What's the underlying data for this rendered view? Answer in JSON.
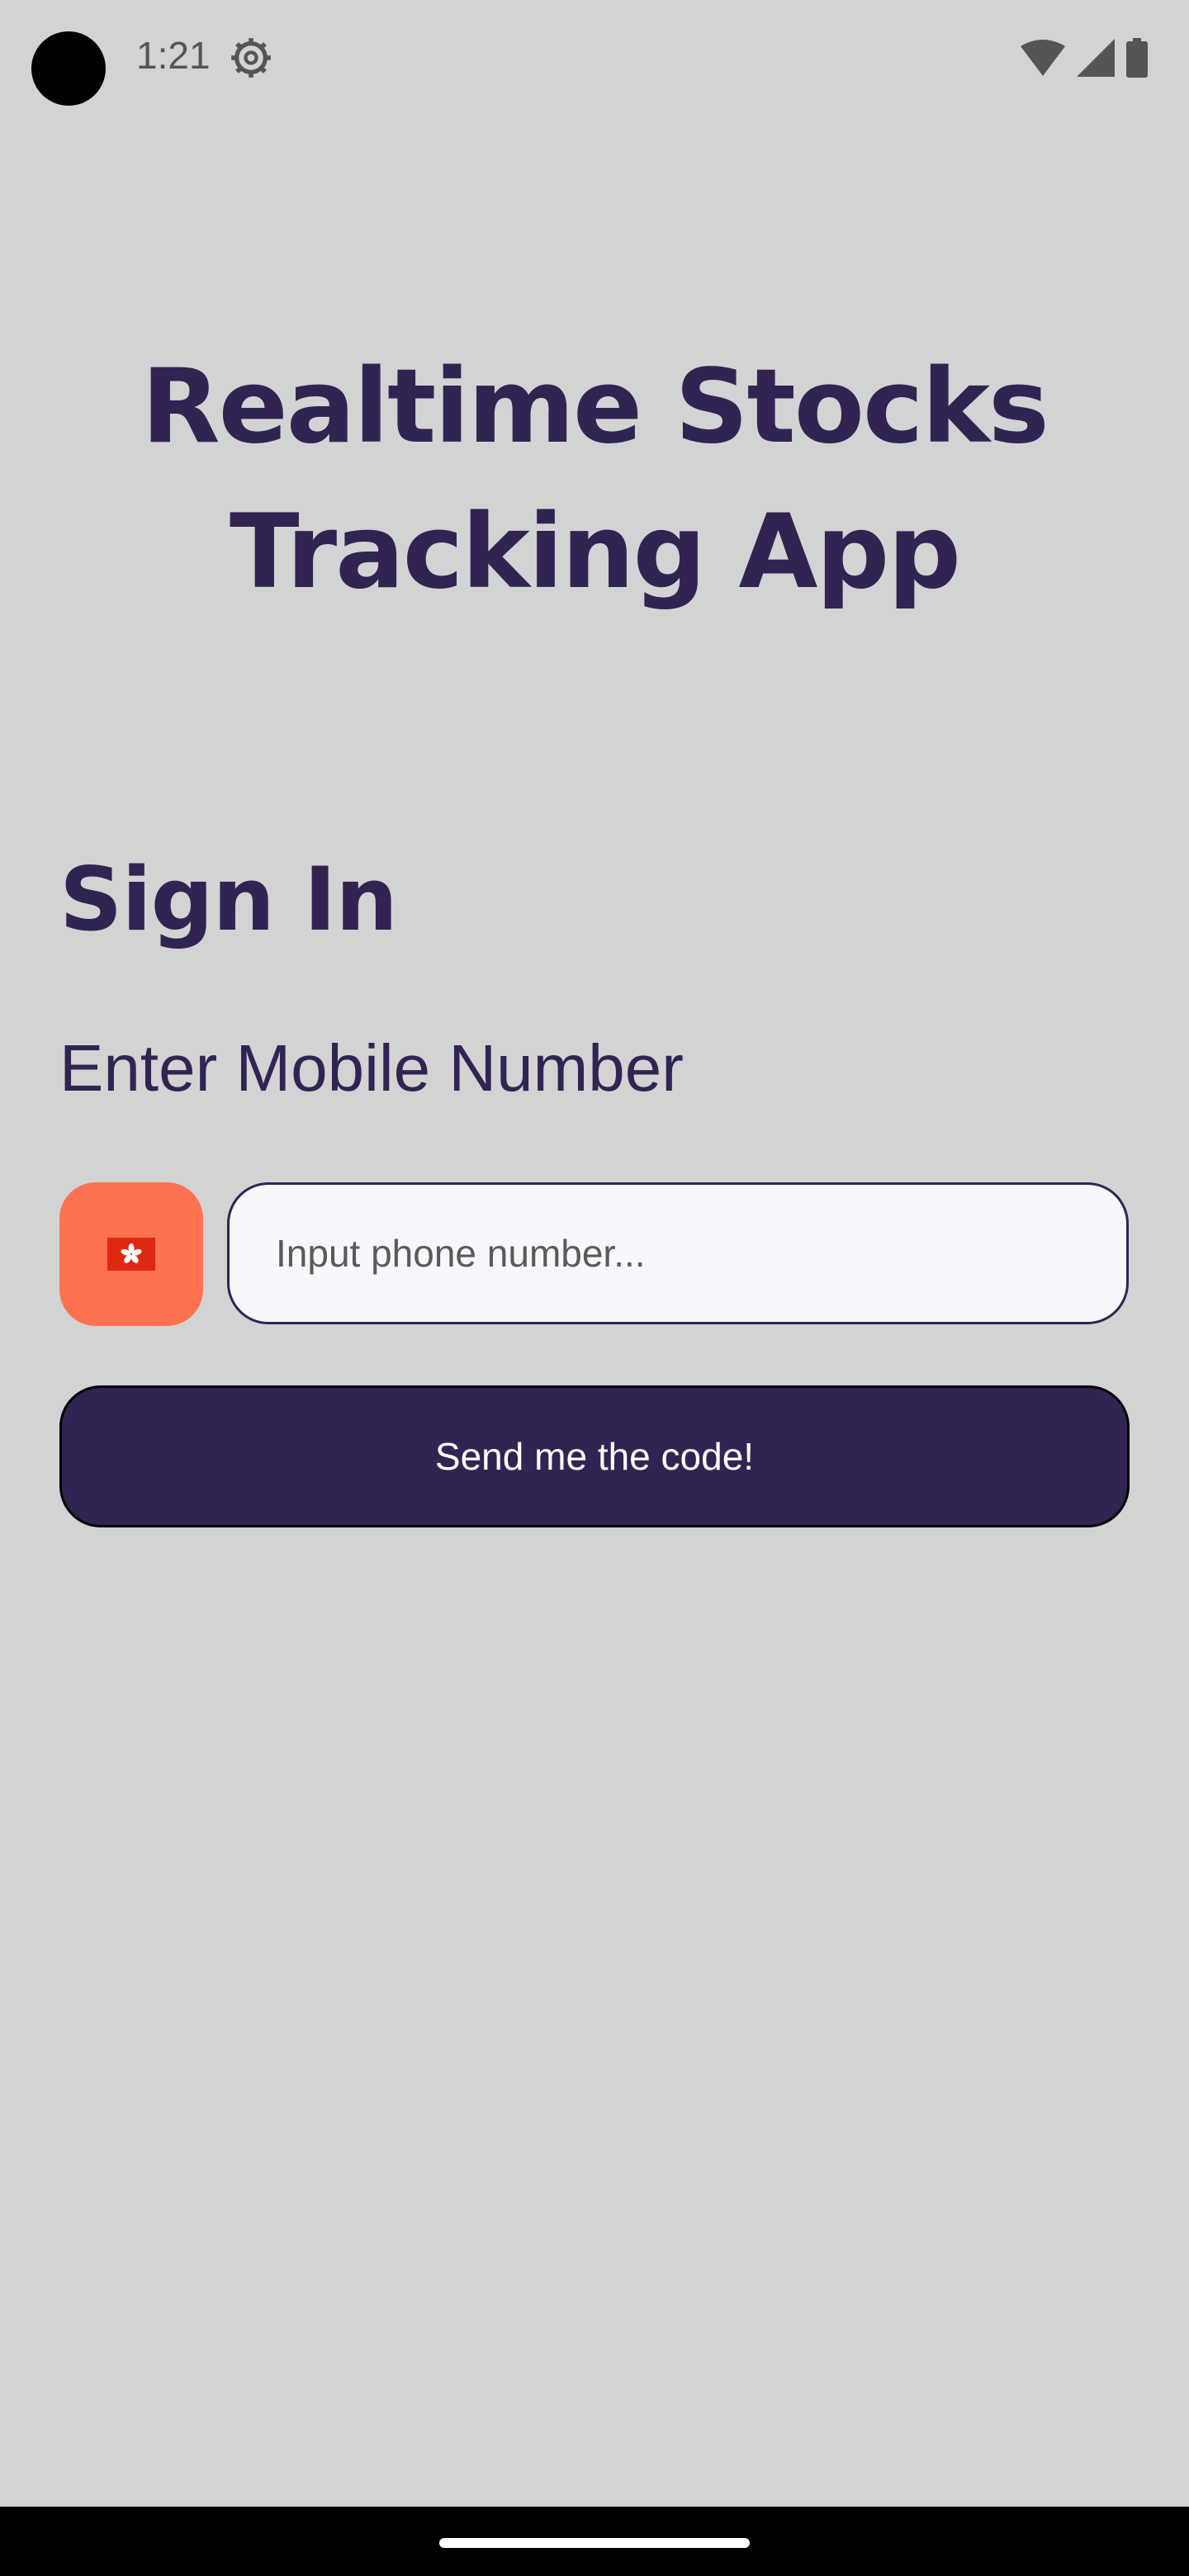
{
  "status_bar": {
    "time": "1:21",
    "icons": [
      "settings-gear-icon",
      "wifi-icon",
      "signal-icon",
      "battery-icon"
    ]
  },
  "app": {
    "title_line1": "Realtime Stocks",
    "title_line2": "Tracking App"
  },
  "signin": {
    "heading": "Sign In",
    "mobile_label": "Enter Mobile Number",
    "country_flag": "hong-kong-flag-icon",
    "phone_placeholder": "Input phone number...",
    "phone_value": "",
    "send_button_label": "Send me the code!"
  },
  "colors": {
    "background": "#d3d3d3",
    "primary": "#312452",
    "accent": "#ff7250",
    "input_bg": "#f8f8fc",
    "button_text": "#ffffff"
  }
}
